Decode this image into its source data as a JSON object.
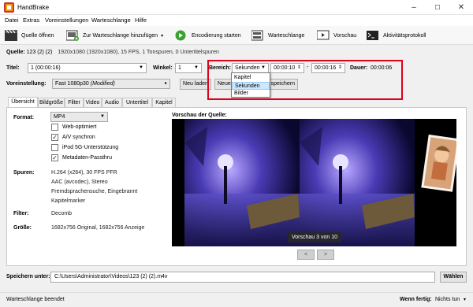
{
  "window": {
    "title": "HandBrake",
    "controls": {
      "minimize": "–",
      "maximize": "☐",
      "close": "✕"
    }
  },
  "menu": [
    "Datei",
    "Extras",
    "Voreinstellungen",
    "Warteschlange",
    "Hilfe"
  ],
  "toolbar": {
    "open_source": "Quelle öffnen",
    "add_queue": "Zur Warteschlange hinzufügen",
    "add_queue_arrow": "▾",
    "start": "Encodierung starten",
    "queue": "Warteschlange",
    "preview": "Vorschau",
    "activity_log": "Aktivitätsprotokoll"
  },
  "source": {
    "label": "Quelle:",
    "value": "123 (2) (2)",
    "details": "1920x1080 (1920x1080), 15 FPS, 1 Tonspuren, 0 Untertitelspuren"
  },
  "title_row": {
    "title_label": "Titel:",
    "title_value": "1 (00:00:16)",
    "angle_label": "Winkel:",
    "angle_value": "1",
    "range_label": "Bereich:",
    "range_value": "Sekunden",
    "start_time": "00:00:10",
    "separator": "-",
    "end_time": "00:00:16",
    "duration_label": "Dauer:",
    "duration_value": "00:00:06"
  },
  "range_options": [
    "Kapitel",
    "Sekunden",
    "Bilder"
  ],
  "range_selected_index": 1,
  "preset_row": {
    "label": "Voreinstellung:",
    "value": "Fast 1080p30",
    "modified": "(Modified)",
    "arrow": "▸",
    "reload": "Neu laden",
    "new_preset_partial": "Neue",
    "save_partial": "speichern"
  },
  "tabs": [
    "Übersicht",
    "Bildgröße",
    "Filter",
    "Video",
    "Audio",
    "Untertitel",
    "Kapitel"
  ],
  "summary": {
    "format_label": "Format:",
    "format_value": "MP4",
    "checkboxes": [
      {
        "label": "Web-optimiert",
        "checked": false
      },
      {
        "label": "A/V synchron",
        "checked": true
      },
      {
        "label": "iPod 5G-Unterstützung",
        "checked": false
      },
      {
        "label": "Metadaten-Passthru",
        "checked": true
      }
    ],
    "tracks_label": "Spuren:",
    "tracks": [
      "H.264 (x264), 30 FPS PFR",
      "AAC (avcodec), Stereo",
      "Fremdsprachensuche, Eingebrannt",
      "Kapitelmarker"
    ],
    "filter_label": "Filter:",
    "filter_value": "Decomb",
    "size_label": "Größe:",
    "size_value": "1682x756 Original, 1682x756 Anzeige"
  },
  "preview": {
    "title": "Vorschau der Quelle:",
    "counter": "Vorschau 3 von 10",
    "prev": "<",
    "next": ">"
  },
  "save": {
    "label": "Speichern unter:",
    "path": "C:\\Users\\Administrator\\Videos\\123 (2) (2).m4v",
    "browse": "Wählen"
  },
  "status": {
    "left": "Warteschlange beendet",
    "when_done_label": "Wenn fertig:",
    "when_done_value": "Nichts tun",
    "when_done_arrow": "▾"
  },
  "colors": {
    "highlight_border": "#e0001a",
    "selected_option": "#cce8ff",
    "start_green": "#3aa22e"
  }
}
